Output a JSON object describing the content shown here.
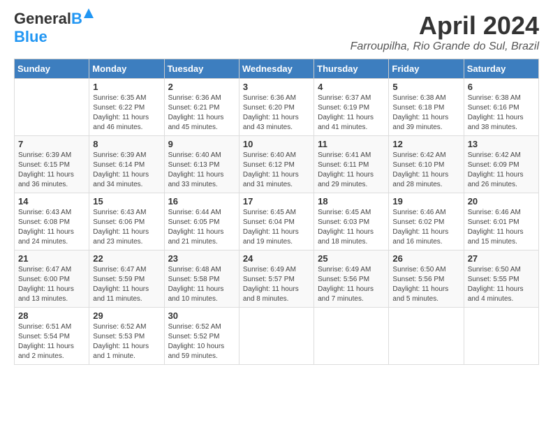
{
  "header": {
    "logo_line1": "General",
    "logo_line2": "Blue",
    "month_title": "April 2024",
    "location": "Farroupilha, Rio Grande do Sul, Brazil"
  },
  "days_of_week": [
    "Sunday",
    "Monday",
    "Tuesday",
    "Wednesday",
    "Thursday",
    "Friday",
    "Saturday"
  ],
  "weeks": [
    [
      {
        "day": "",
        "info": ""
      },
      {
        "day": "1",
        "info": "Sunrise: 6:35 AM\nSunset: 6:22 PM\nDaylight: 11 hours\nand 46 minutes."
      },
      {
        "day": "2",
        "info": "Sunrise: 6:36 AM\nSunset: 6:21 PM\nDaylight: 11 hours\nand 45 minutes."
      },
      {
        "day": "3",
        "info": "Sunrise: 6:36 AM\nSunset: 6:20 PM\nDaylight: 11 hours\nand 43 minutes."
      },
      {
        "day": "4",
        "info": "Sunrise: 6:37 AM\nSunset: 6:19 PM\nDaylight: 11 hours\nand 41 minutes."
      },
      {
        "day": "5",
        "info": "Sunrise: 6:38 AM\nSunset: 6:18 PM\nDaylight: 11 hours\nand 39 minutes."
      },
      {
        "day": "6",
        "info": "Sunrise: 6:38 AM\nSunset: 6:16 PM\nDaylight: 11 hours\nand 38 minutes."
      }
    ],
    [
      {
        "day": "7",
        "info": "Sunrise: 6:39 AM\nSunset: 6:15 PM\nDaylight: 11 hours\nand 36 minutes."
      },
      {
        "day": "8",
        "info": "Sunrise: 6:39 AM\nSunset: 6:14 PM\nDaylight: 11 hours\nand 34 minutes."
      },
      {
        "day": "9",
        "info": "Sunrise: 6:40 AM\nSunset: 6:13 PM\nDaylight: 11 hours\nand 33 minutes."
      },
      {
        "day": "10",
        "info": "Sunrise: 6:40 AM\nSunset: 6:12 PM\nDaylight: 11 hours\nand 31 minutes."
      },
      {
        "day": "11",
        "info": "Sunrise: 6:41 AM\nSunset: 6:11 PM\nDaylight: 11 hours\nand 29 minutes."
      },
      {
        "day": "12",
        "info": "Sunrise: 6:42 AM\nSunset: 6:10 PM\nDaylight: 11 hours\nand 28 minutes."
      },
      {
        "day": "13",
        "info": "Sunrise: 6:42 AM\nSunset: 6:09 PM\nDaylight: 11 hours\nand 26 minutes."
      }
    ],
    [
      {
        "day": "14",
        "info": "Sunrise: 6:43 AM\nSunset: 6:08 PM\nDaylight: 11 hours\nand 24 minutes."
      },
      {
        "day": "15",
        "info": "Sunrise: 6:43 AM\nSunset: 6:06 PM\nDaylight: 11 hours\nand 23 minutes."
      },
      {
        "day": "16",
        "info": "Sunrise: 6:44 AM\nSunset: 6:05 PM\nDaylight: 11 hours\nand 21 minutes."
      },
      {
        "day": "17",
        "info": "Sunrise: 6:45 AM\nSunset: 6:04 PM\nDaylight: 11 hours\nand 19 minutes."
      },
      {
        "day": "18",
        "info": "Sunrise: 6:45 AM\nSunset: 6:03 PM\nDaylight: 11 hours\nand 18 minutes."
      },
      {
        "day": "19",
        "info": "Sunrise: 6:46 AM\nSunset: 6:02 PM\nDaylight: 11 hours\nand 16 minutes."
      },
      {
        "day": "20",
        "info": "Sunrise: 6:46 AM\nSunset: 6:01 PM\nDaylight: 11 hours\nand 15 minutes."
      }
    ],
    [
      {
        "day": "21",
        "info": "Sunrise: 6:47 AM\nSunset: 6:00 PM\nDaylight: 11 hours\nand 13 minutes."
      },
      {
        "day": "22",
        "info": "Sunrise: 6:47 AM\nSunset: 5:59 PM\nDaylight: 11 hours\nand 11 minutes."
      },
      {
        "day": "23",
        "info": "Sunrise: 6:48 AM\nSunset: 5:58 PM\nDaylight: 11 hours\nand 10 minutes."
      },
      {
        "day": "24",
        "info": "Sunrise: 6:49 AM\nSunset: 5:57 PM\nDaylight: 11 hours\nand 8 minutes."
      },
      {
        "day": "25",
        "info": "Sunrise: 6:49 AM\nSunset: 5:56 PM\nDaylight: 11 hours\nand 7 minutes."
      },
      {
        "day": "26",
        "info": "Sunrise: 6:50 AM\nSunset: 5:56 PM\nDaylight: 11 hours\nand 5 minutes."
      },
      {
        "day": "27",
        "info": "Sunrise: 6:50 AM\nSunset: 5:55 PM\nDaylight: 11 hours\nand 4 minutes."
      }
    ],
    [
      {
        "day": "28",
        "info": "Sunrise: 6:51 AM\nSunset: 5:54 PM\nDaylight: 11 hours\nand 2 minutes."
      },
      {
        "day": "29",
        "info": "Sunrise: 6:52 AM\nSunset: 5:53 PM\nDaylight: 11 hours\nand 1 minute."
      },
      {
        "day": "30",
        "info": "Sunrise: 6:52 AM\nSunset: 5:52 PM\nDaylight: 10 hours\nand 59 minutes."
      },
      {
        "day": "",
        "info": ""
      },
      {
        "day": "",
        "info": ""
      },
      {
        "day": "",
        "info": ""
      },
      {
        "day": "",
        "info": ""
      }
    ]
  ]
}
